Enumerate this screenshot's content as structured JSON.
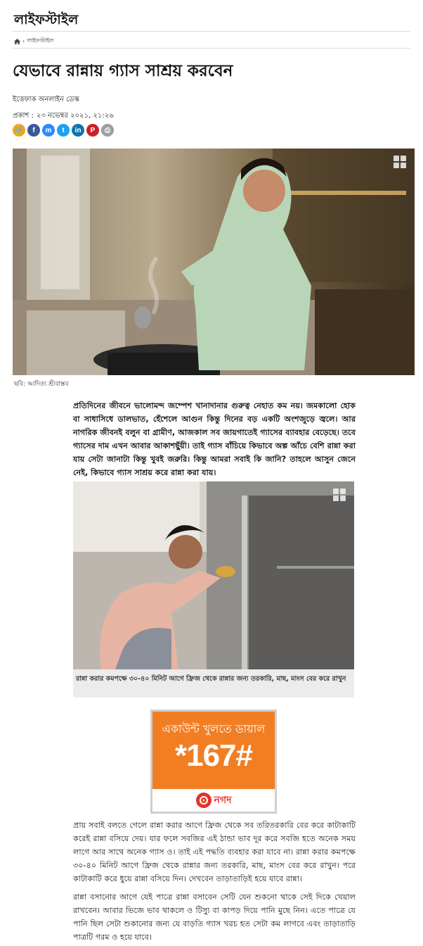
{
  "header": {
    "section": "লাইফস্টাইল"
  },
  "breadcrumb": {
    "home_icon": "home-icon",
    "separator": "›",
    "current": "লাইফস্টাইল"
  },
  "article": {
    "title": "যেভাবে রান্নায় গ্যাস সাশ্রয় করবেন",
    "author": "ইত্তেফাক অনলাইন ডেস্ক",
    "published_label": "প্রকাশ :",
    "published_date": "২৩ নভেম্বর ২০২১, ২১:২৬"
  },
  "share": [
    {
      "icon": "link-icon",
      "color": "#f2a516",
      "glyph": "🔗"
    },
    {
      "icon": "facebook-icon",
      "color": "#3b5998",
      "glyph": "f"
    },
    {
      "icon": "messenger-icon",
      "color": "#2e89ff",
      "glyph": "m"
    },
    {
      "icon": "twitter-icon",
      "color": "#1da1f2",
      "glyph": "t"
    },
    {
      "icon": "linkedin-icon",
      "color": "#0e76a8",
      "glyph": "in"
    },
    {
      "icon": "pinterest-icon",
      "color": "#cb2027",
      "glyph": "P"
    },
    {
      "icon": "print-icon",
      "color": "#9e9e9e",
      "glyph": "⎙"
    }
  ],
  "lead_image": {
    "caption": "ছবি: আদিত্য শ্রীবাস্তব"
  },
  "body": {
    "intro": "প্রতিদিনের জীবনে ভালোমন্দ জম্পেশ খানাদানার গুরুত্ব নেহাত কম নয়। জমকালো হোক বা সাধাসিধে ডালভাত, হেঁশেলে আগুন কিন্তু দিনের বড় একটি অংশজুড়ে জ্বলে। আর নাগরিক জীবনই বলুন বা গ্রামীণ, আজকাল সব জায়গাতেই গ্যাসের ব্যাবহার বেড়েছে। তবে গ্যাসের দাম এখন আবার আকাশছুঁয়ী। তাই গ্যাস বাঁচিয়ে কিভাবে অল্প আঁচে বেশি রান্না করা যায় সেটা জানাটা কিন্তু খুবই জরুরি। কিন্তু আমরা সবাই কি জানি? তাহলে আসুন জেনে নেই, কিভাবে গ্যাস সাশ্রয় করে রান্না করা যায়।",
    "inline_caption": "রান্না করার কমপক্ষে ৩০-৪০ মিনিট আগে ফ্রিজ থেকে রান্নার জন্য তরকারি, মাছ, মাংস বের করে রাখুন",
    "p2": "প্রায় সবাই বলতে গেলে রান্না করার আগে ফ্রিজ থেকে সব তরিতরকারি বের করে কাটাকাটি করেই রান্না বসিয়ে দেয়। যার ফলে সবজির এই ঠান্ডা ভাব দূর করে সবজি হতে অনেক সময় লাগে আর সাথে অনেক গ্যাস ও। তাই এই পদ্ধতি ব্যবহার করা যাবে না। রান্না করার কমপক্ষে ৩০-৪০ মিনিট আগে ফ্রিজ থেকে রান্নার জন্য তরকারি, মাছ, মাংস বের করে রাখুন। পরে কাটাকাটি করে ধুয়ে রান্না বসিয়ে দিন। দেখবেন তাড়াতাড়িই হয়ে যাবে রান্না।",
    "p3": "রান্না বসানোর আগে যেই পাত্রে রান্না বসাবেন সেটি যেন শুকনো থাকে সেই দিকে খেয়াল রাখবেন। আবার ভিজে ভাব থাকলে ও টিস্যু বা কাপড় দিয়ে পানি মুছে নিন। এতে পাত্রে যে পানি ছিল সেটা শুকানোর জন্য যে বাড়তি গ্যাস খরচ হত সেটা কম লাগবে এবং তাড়াতাড়ি পাত্রটি গরম ও হয়ে যাবে।"
  },
  "ad": {
    "line1": "একাউন্ট খুলতে ডায়াল",
    "line2": "*167#",
    "brand": "নগদ",
    "color": "#f27e24"
  }
}
